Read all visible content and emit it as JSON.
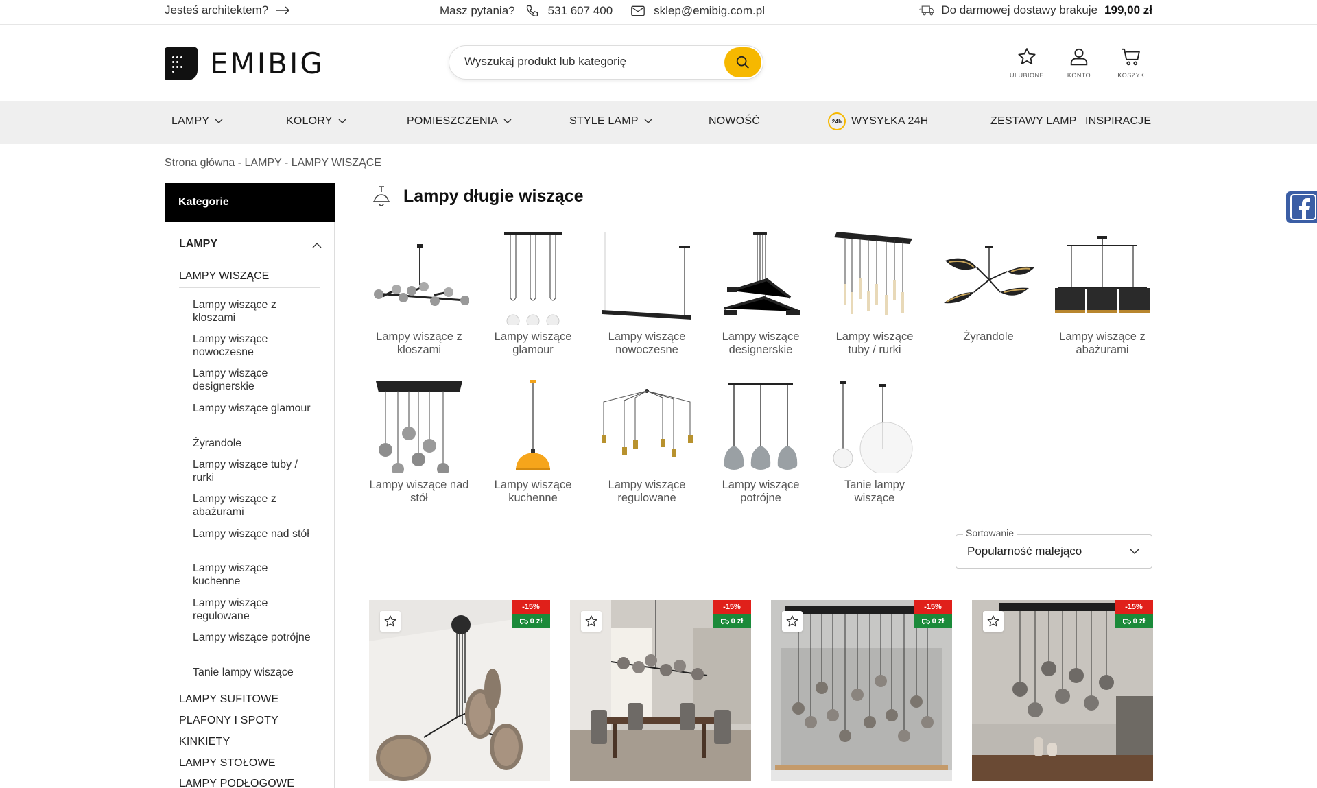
{
  "topbar": {
    "architect": "Jesteś architektem?",
    "questions": "Masz pytania?",
    "phone": "531 607 400",
    "email": "sklep@emibig.com.pl",
    "shipping_text": "Do darmowej dostawy brakuje",
    "shipping_amount": "199,00 zł"
  },
  "header": {
    "logo_text": "EMIBIG",
    "search_placeholder": "Wyszukaj produkt lub kategorię",
    "favorites_label": "ULUBIONE",
    "account_label": "KONTO",
    "cart_label": "KOSZYK",
    "accent_color": "#f6b800"
  },
  "nav": {
    "items": [
      "LAMPY",
      "KOLORY",
      "POMIESZCZENIA",
      "STYLE LAMP",
      "NOWOŚĆ",
      "WYSYŁKA 24H",
      "ZESTAWY LAMP",
      "INSPIRACJE"
    ],
    "badge": "24h"
  },
  "breadcrumb": {
    "home": "Strona główna",
    "sep": " - ",
    "level1": "LAMPY",
    "level2": "LAMPY WISZĄCE"
  },
  "sidebar": {
    "title": "Kategorie",
    "group": "LAMPY",
    "active": "LAMPY WISZĄCE",
    "subitems": [
      "Lampy wiszące z kloszami",
      "Lampy wiszące nowoczesne",
      "Lampy wiszące designerskie",
      "Lampy wiszące glamour",
      "Żyrandole",
      "Lampy wiszące tuby / rurki",
      "Lampy wiszące z abażurami",
      "Lampy wiszące nad stół",
      "Lampy wiszące kuchenne",
      "Lampy wiszące regulowane",
      "Lampy wiszące potrójne",
      "Tanie lampy wiszące"
    ],
    "main_items": [
      "LAMPY SUFITOWE",
      "PLAFONY I SPOTY",
      "KINKIETY",
      "LAMPY STOŁOWE",
      "LAMPY PODŁOGOWE"
    ]
  },
  "main": {
    "title": "Lampy długie wiszące",
    "categories": [
      "Lampy wiszące z kloszami",
      "Lampy wiszące glamour",
      "Lampy wiszące nowoczesne",
      "Lampy wiszące designerskie",
      "Lampy wiszące tuby / rurki",
      "Żyrandole",
      "Lampy wiszące z abażurami",
      "Lampy wiszące nad stół",
      "Lampy wiszące kuchenne",
      "Lampy wiszące regulowane",
      "Lampy wiszące potrójne",
      "Tanie lampy wiszące"
    ],
    "sorting_label": "Sortowanie",
    "sorting_value": "Popularność malejąco",
    "products": [
      {
        "discount": "-15%",
        "shipping": "0 zł"
      },
      {
        "discount": "-15%",
        "shipping": "0 zł"
      },
      {
        "discount": "-15%",
        "shipping": "0 zł"
      },
      {
        "discount": "-15%",
        "shipping": "0 zł"
      }
    ],
    "discount_color": "#e0201a",
    "free_shipping_color": "#1b8a3a"
  }
}
